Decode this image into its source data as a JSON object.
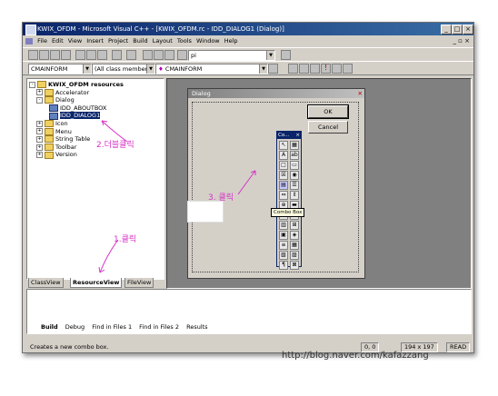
{
  "window": {
    "title": "KWIX_OFDM - Microsoft Visual C++ - [KWIX_OFDM.rc - IDD_DIALOG1 (Dialog)]",
    "buttons": [
      "_",
      "□",
      "×"
    ]
  },
  "menu": [
    "File",
    "Edit",
    "View",
    "Insert",
    "Project",
    "Build",
    "Layout",
    "Tools",
    "Window",
    "Help"
  ],
  "mdi_buttons": "_ ▫ ×",
  "toolbar": {
    "find_value": "pi",
    "class_value": "CMAINFORM",
    "members_value": "(All class members)",
    "function_value": "CMAINFORM"
  },
  "tree": {
    "root": "KWIX_OFDM resources",
    "items": [
      {
        "label": "Accelerator",
        "level": 1
      },
      {
        "label": "Dialog",
        "level": 1
      },
      {
        "label": "IDD_ABOUTBOX",
        "level": 2
      },
      {
        "label": "IDD_DIALOG1",
        "level": 2
      },
      {
        "label": "Icon",
        "level": 1
      },
      {
        "label": "Menu",
        "level": 1
      },
      {
        "label": "String Table",
        "level": 1
      },
      {
        "label": "Toolbar",
        "level": 1
      },
      {
        "label": "Version",
        "level": 1
      }
    ]
  },
  "workspace_tabs": [
    "ClassView",
    "ResourceView",
    "FileView"
  ],
  "dialog": {
    "title": "Dialog",
    "ok": "OK",
    "cancel": "Cancel"
  },
  "controls_title": "Co...",
  "tooltip": "Combo Box",
  "output_tabs": [
    "Build",
    "Debug",
    "Find in Files 1",
    "Find in Files 2",
    "Results"
  ],
  "status": {
    "message": "Creates a new combo box.",
    "position": "0, 0",
    "size": "194 x 197",
    "mode": "READ"
  },
  "annotations": {
    "double_click": "2.더블클릭",
    "click1": "1.클릭",
    "click3": "3. 클릭"
  },
  "blog_url": "http://blog.naver.com/kafazzang"
}
